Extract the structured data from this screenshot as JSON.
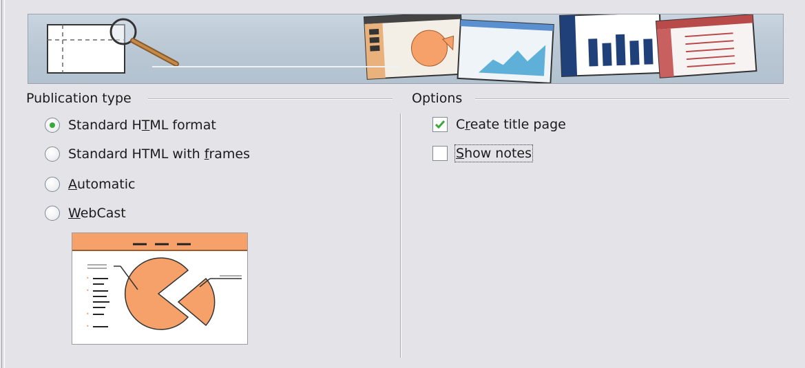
{
  "publication_type": {
    "title": "Publication type",
    "options": [
      {
        "pre": "Standard H",
        "mnemonic": "T",
        "post": "ML format",
        "selected": true
      },
      {
        "pre": "Standard HTML with ",
        "mnemonic": "f",
        "post": "rames",
        "selected": false
      },
      {
        "pre": "",
        "mnemonic": "A",
        "post": "utomatic",
        "selected": false
      },
      {
        "pre": "",
        "mnemonic": "W",
        "post": "ebCast",
        "selected": false
      }
    ]
  },
  "options_section": {
    "title": "Options",
    "checkboxes": [
      {
        "pre": "C",
        "mnemonic": "r",
        "post": "eate title page",
        "checked": true
      },
      {
        "pre": "",
        "mnemonic": "S",
        "post": "how notes",
        "checked": false
      }
    ]
  },
  "colors": {
    "accent_orange": "#f6a06a",
    "check_green": "#3aa83a"
  }
}
